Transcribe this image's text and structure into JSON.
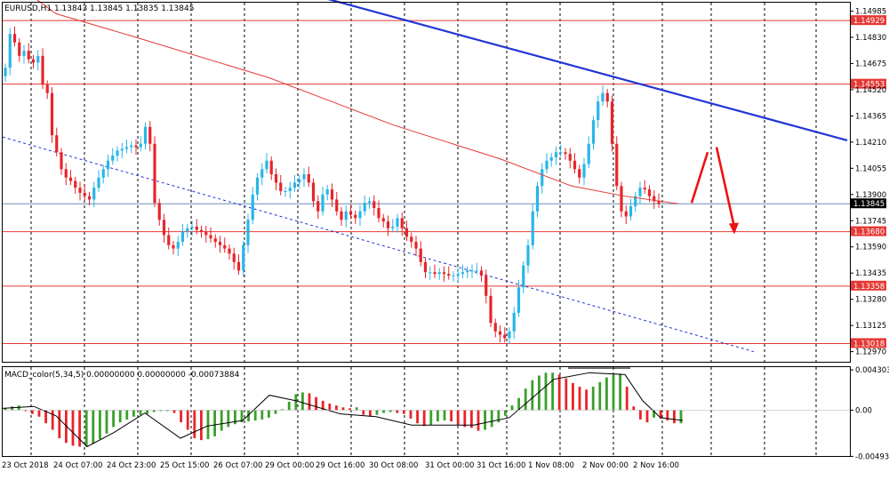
{
  "header": {
    "symbol_label": "EURUSD,H1  1.13843 1.13845 1.13835 1.13845",
    "macd_label": "MACD_color(5,34,5) 0.00000000 0.00000000 -0.00073884"
  },
  "colors": {
    "bull": "#29b6e8",
    "bear": "#e8242a",
    "ma": "#e53935",
    "trend": "#1f35d6",
    "support": "#e53935",
    "hist_up": "#3aa02a",
    "hist_down": "#e8242a",
    "signal": "#000000",
    "grid": "#000000"
  },
  "chart_data": [
    {
      "type": "candlestick",
      "title": "EURUSD,H1",
      "x_ticks": [
        "23 Oct 2018",
        "24 Oct 07:00",
        "24 Oct 23:00",
        "25 Oct 15:00",
        "26 Oct 07:00",
        "29 Oct 00:00",
        "29 Oct 16:00",
        "30 Oct 08:00",
        "31 Oct 00:00",
        "31 Oct 16:00",
        "1 Nov 08:00",
        "2 Nov 00:00",
        "2 Nov 16:00"
      ],
      "y_ticks": [
        "1.14985",
        "1.14830",
        "1.14675",
        "1.14520",
        "1.14365",
        "1.14210",
        "1.14055",
        "1.13900",
        "1.13745",
        "1.13590",
        "1.13435",
        "1.13280",
        "1.13125",
        "1.12970"
      ],
      "ylim": [
        1.1291,
        1.15035
      ],
      "current_price": "1.13845",
      "horizontal_levels": [
        {
          "value": 1.14929,
          "label": "1.14929"
        },
        {
          "value": 1.14553,
          "label": "1.14553"
        },
        {
          "value": 1.1368,
          "label": "1.13680"
        },
        {
          "value": 1.13358,
          "label": "1.13358"
        },
        {
          "value": 1.13018,
          "label": "1.13018"
        }
      ],
      "candles_close": [
        1.1465,
        1.1485,
        1.148,
        1.1472,
        1.1475,
        1.147,
        1.1468,
        1.1472,
        1.1455,
        1.145,
        1.1425,
        1.1415,
        1.1405,
        1.14,
        1.1398,
        1.1394,
        1.1391,
        1.1389,
        1.1387,
        1.1394,
        1.14,
        1.1405,
        1.141,
        1.1413,
        1.1416,
        1.1417,
        1.1418,
        1.1419,
        1.1418,
        1.142,
        1.143,
        1.142,
        1.1385,
        1.1375,
        1.1366,
        1.136,
        1.1358,
        1.1362,
        1.1368,
        1.137,
        1.1371,
        1.1369,
        1.1368,
        1.1366,
        1.1364,
        1.1362,
        1.136,
        1.1358,
        1.1355,
        1.135,
        1.1345,
        1.136,
        1.1375,
        1.139,
        1.14,
        1.1405,
        1.141,
        1.1402,
        1.1397,
        1.1392,
        1.1392,
        1.1394,
        1.1397,
        1.1399,
        1.1402,
        1.1397,
        1.1386,
        1.138,
        1.139,
        1.1393,
        1.1387,
        1.138,
        1.1375,
        1.138,
        1.1378,
        1.1376,
        1.138,
        1.1385,
        1.1386,
        1.1382,
        1.1376,
        1.1374,
        1.137,
        1.1371,
        1.1376,
        1.137,
        1.1365,
        1.1362,
        1.1358,
        1.135,
        1.1344,
        1.1344,
        1.1343,
        1.1344,
        1.1343,
        1.1342,
        1.1342,
        1.1343,
        1.1344,
        1.1345,
        1.1345,
        1.1345,
        1.1342,
        1.133,
        1.1314,
        1.1309,
        1.1307,
        1.1305,
        1.1309,
        1.132,
        1.1335,
        1.1348,
        1.136,
        1.138,
        1.1395,
        1.1405,
        1.141,
        1.1412,
        1.1415,
        1.1415,
        1.1414,
        1.141,
        1.1405,
        1.14,
        1.1408,
        1.142,
        1.1434,
        1.1445,
        1.145,
        1.1445,
        1.142,
        1.1395,
        1.138,
        1.1377,
        1.1383,
        1.1389,
        1.1394,
        1.1393,
        1.1389,
        1.1386,
        1.13845
      ],
      "ma_curve": [
        [
          0,
          1.152
        ],
        [
          60,
          1.1497
        ],
        [
          150,
          1.1483
        ],
        [
          300,
          1.1459
        ],
        [
          440,
          1.1431
        ],
        [
          560,
          1.1411
        ],
        [
          640,
          1.1395
        ],
        [
          700,
          1.1389
        ],
        [
          760,
          1.13845
        ]
      ],
      "trendlines": [
        {
          "style": "solid",
          "from": [
            0,
            1.1558
          ],
          "to": [
            950,
            1.1422
          ]
        },
        {
          "style": "dotted",
          "from": [
            0,
            1.1424
          ],
          "to": [
            845,
            1.1297
          ]
        }
      ],
      "projection": [
        {
          "from": [
            775,
            1.1385
          ],
          "to": [
            793,
            1.1415
          ]
        },
        {
          "from": [
            803,
            1.1418
          ],
          "to": [
            823,
            1.13675
          ]
        }
      ]
    },
    {
      "type": "bar",
      "title": "MACD_color(5,34,5)",
      "y_ticks": [
        "0.004303",
        "0.00",
        "-0.004939"
      ],
      "ylim": [
        -0.0049,
        0.0046
      ],
      "histogram": [
        0.0002,
        0.0004,
        0.0005,
        -0.0001,
        -0.0004,
        -0.0007,
        -0.0014,
        -0.0021,
        -0.003,
        -0.0035,
        -0.0038,
        -0.0039,
        -0.0039,
        -0.0036,
        -0.0031,
        -0.0025,
        -0.0018,
        -0.0013,
        -0.001,
        -0.0007,
        -0.0005,
        -0.0004,
        -0.0002,
        -0.0001,
        -0.0001,
        -0.0003,
        -0.0013,
        -0.0021,
        -0.003,
        -0.0032,
        -0.0031,
        -0.0028,
        -0.0022,
        -0.0018,
        -0.0015,
        -0.0013,
        -0.0012,
        -0.0011,
        -0.001,
        -0.0008,
        -0.0004,
        0.0001,
        0.0009,
        0.0017,
        0.0019,
        0.0018,
        0.0014,
        0.001,
        0.0007,
        0.0005,
        0.0003,
        0.0002,
        0.0003,
        -0.0005,
        -0.0007,
        -0.0005,
        -0.0003,
        -0.0002,
        -0.0003,
        -0.0004,
        -0.0009,
        -0.0014,
        -0.0017,
        -0.0016,
        -0.0012,
        -0.0011,
        -0.0012,
        -0.0016,
        -0.0018,
        -0.0019,
        -0.0022,
        -0.0021,
        -0.0018,
        -0.0013,
        -0.0006,
        0.0005,
        0.0013,
        0.0023,
        0.0032,
        0.0037,
        0.004,
        0.004,
        0.0038,
        0.0034,
        0.0029,
        0.0025,
        0.0022,
        0.0025,
        0.003,
        0.0035,
        0.0038,
        0.0039,
        0.0025,
        0.0004,
        -0.001,
        -0.0013,
        -0.0008,
        -0.0009,
        -0.0011,
        -0.0014,
        -0.0014
      ],
      "signal_curve": [
        [
          0,
          0.0002
        ],
        [
          35,
          0.0004
        ],
        [
          60,
          -0.0006
        ],
        [
          95,
          -0.0039
        ],
        [
          125,
          -0.0024
        ],
        [
          160,
          -0.0003
        ],
        [
          200,
          -0.003
        ],
        [
          230,
          -0.0017
        ],
        [
          270,
          -0.0011
        ],
        [
          300,
          0.0016
        ],
        [
          330,
          0.001
        ],
        [
          380,
          -0.0004
        ],
        [
          420,
          -0.0007
        ],
        [
          460,
          -0.0016
        ],
        [
          530,
          -0.0016
        ],
        [
          570,
          -0.0008
        ],
        [
          620,
          0.0033
        ],
        [
          660,
          0.004
        ],
        [
          700,
          0.0038
        ],
        [
          720,
          0.001
        ],
        [
          740,
          -0.0008
        ],
        [
          765,
          -0.0011
        ]
      ],
      "divergence_line": [
        [
          636,
          0.0045
        ],
        [
          706,
          0.0045
        ]
      ]
    }
  ]
}
